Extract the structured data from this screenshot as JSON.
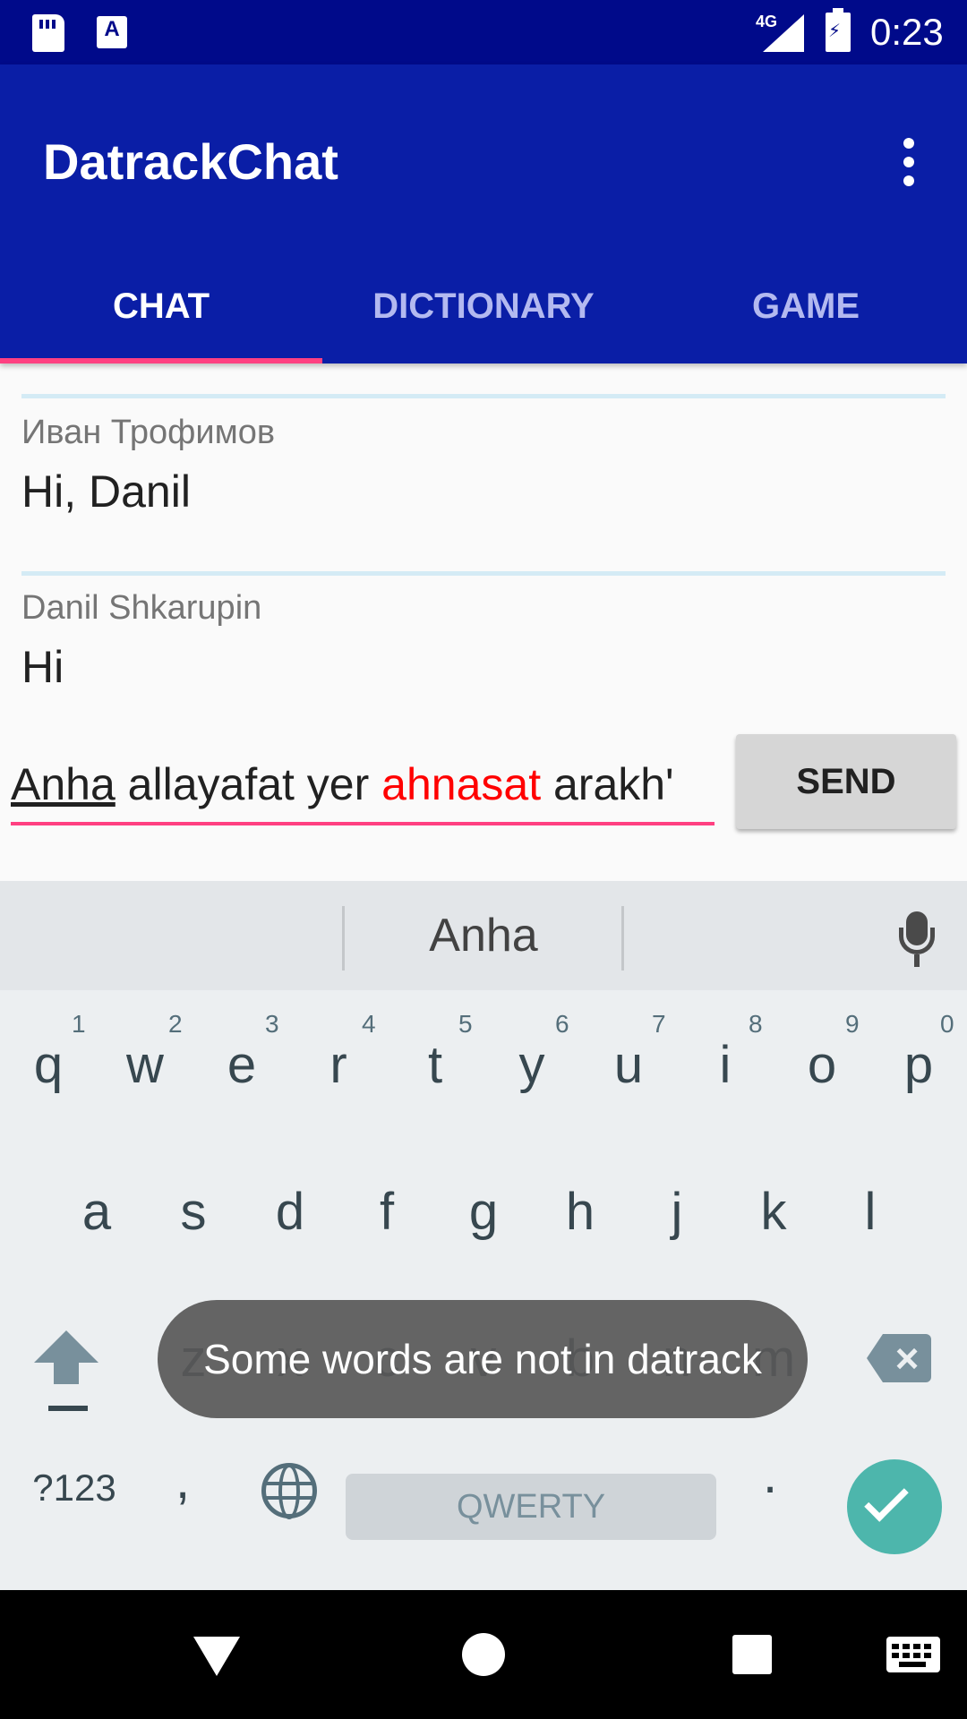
{
  "status_bar": {
    "network": "4G",
    "time": "0:23"
  },
  "app_bar": {
    "title": "DatrackChat",
    "tabs": [
      {
        "label": "CHAT",
        "active": true
      },
      {
        "label": "DICTIONARY",
        "active": false
      },
      {
        "label": "GAME",
        "active": false
      }
    ],
    "accent": "#ff4081",
    "color": "#0a1ea6"
  },
  "messages": [
    {
      "author": "Иван Трофимов",
      "text": "Hi, Danil"
    },
    {
      "author": "Danil Shkarupin",
      "text": "Hi"
    }
  ],
  "composer": {
    "input_words": [
      {
        "text": "Anha",
        "style": "underline"
      },
      {
        "text": " allayafat yer ",
        "style": "normal"
      },
      {
        "text": "ahnasat",
        "style": "red"
      },
      {
        "text": " arakh'",
        "style": "normal"
      }
    ],
    "send_label": "SEND"
  },
  "keyboard": {
    "suggestion": "Anha",
    "row1": [
      "q",
      "w",
      "e",
      "r",
      "t",
      "y",
      "u",
      "i",
      "o",
      "p"
    ],
    "row1_numbers": [
      "1",
      "2",
      "3",
      "4",
      "5",
      "6",
      "7",
      "8",
      "9",
      "0"
    ],
    "row2": [
      "a",
      "s",
      "d",
      "f",
      "g",
      "h",
      "j",
      "k",
      "l"
    ],
    "row3": [
      "z",
      "x",
      "c",
      "v",
      "b",
      "n",
      "m"
    ],
    "symbols_label": "?123",
    "comma": ",",
    "space_label": "QWERTY",
    "period": ".",
    "enter_color": "#4db6ac"
  },
  "toast": {
    "text": "Some words are not in datrack"
  }
}
